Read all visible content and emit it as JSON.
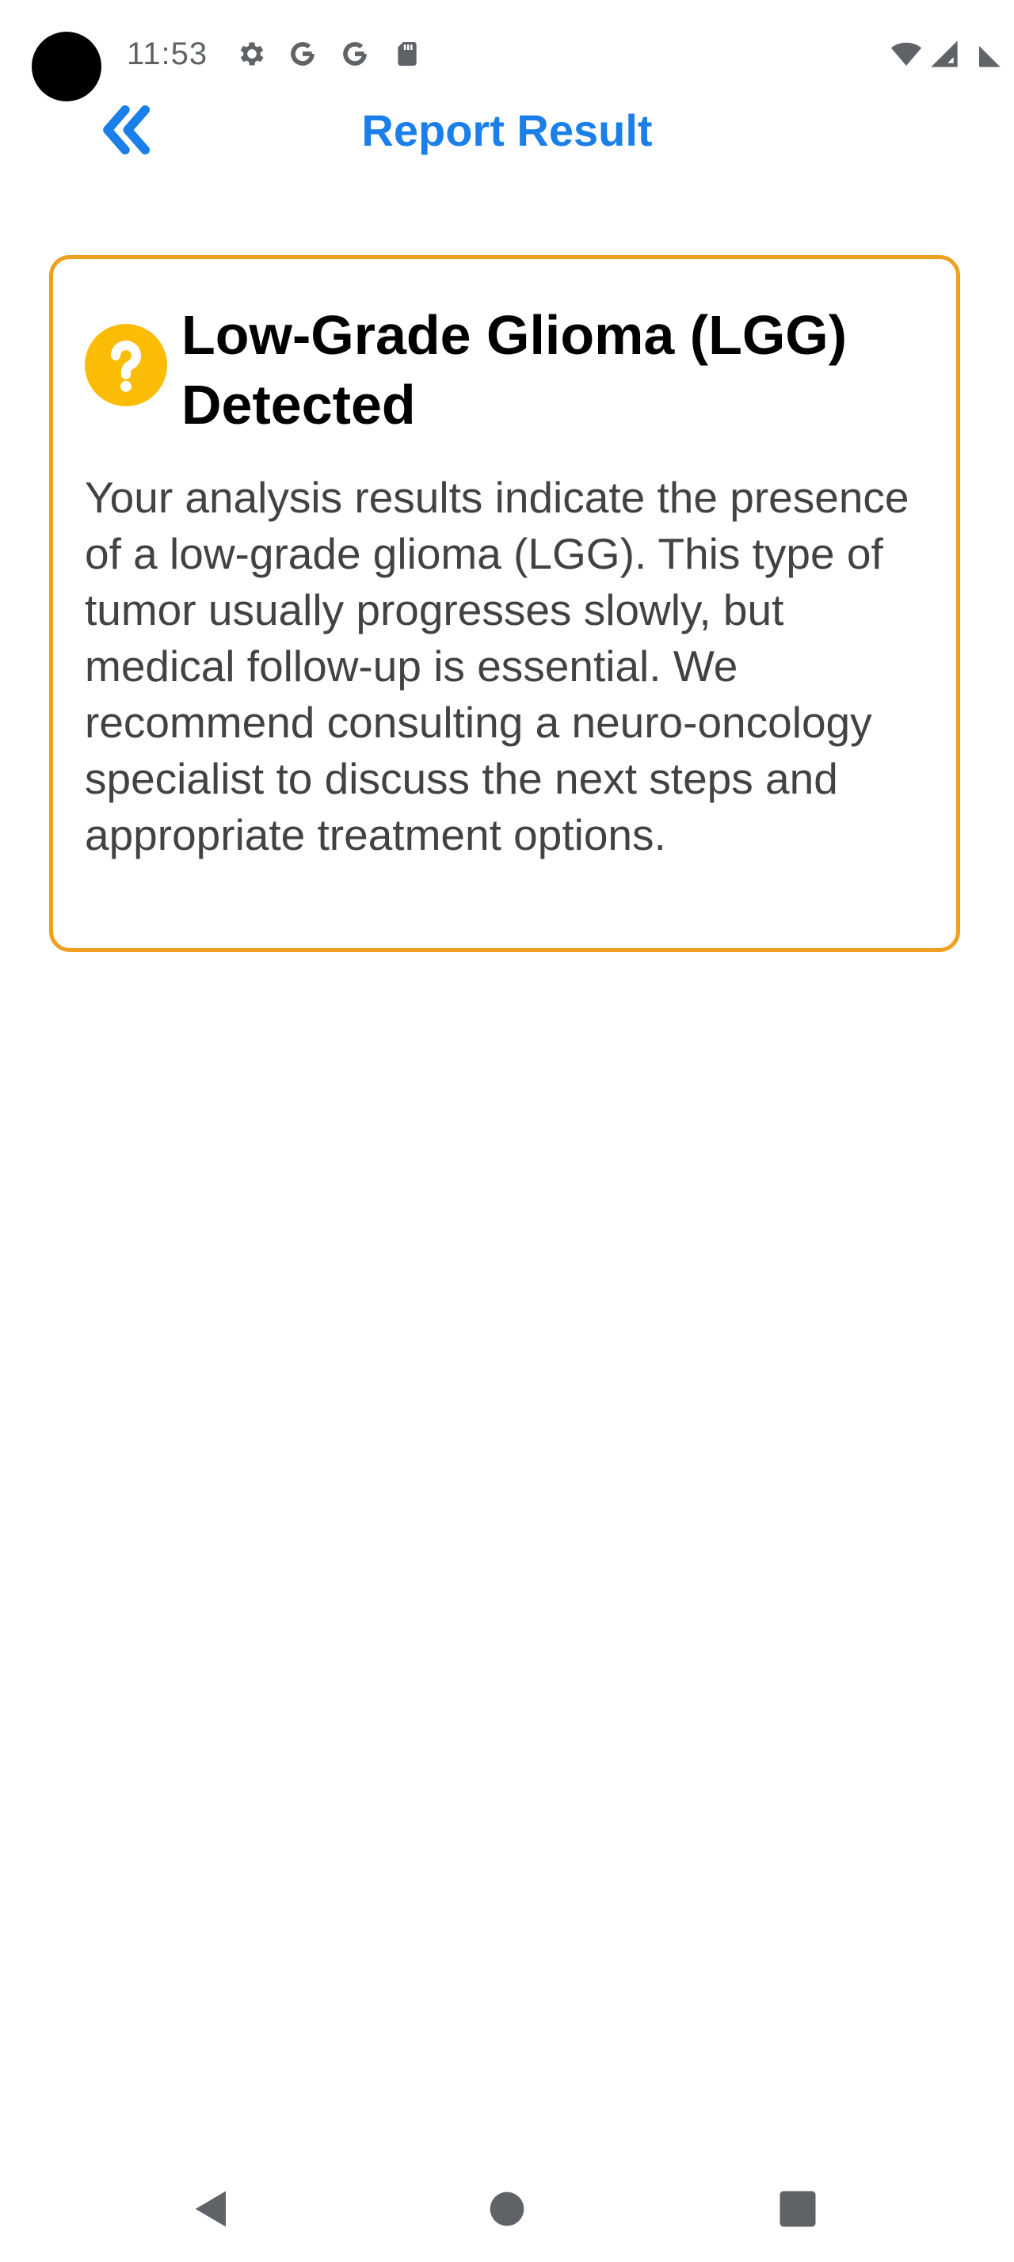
{
  "status_bar": {
    "time": "11:53",
    "icons": [
      "settings-icon",
      "google-icon",
      "google-icon",
      "sd-card-icon",
      "wifi-icon",
      "signal-icon",
      "signal-partial-icon"
    ]
  },
  "header": {
    "title": "Report Result",
    "back_icon": "double-chevron-left-icon",
    "accent_color": "#1a7fe8"
  },
  "result_card": {
    "icon": "question-mark-circle-icon",
    "icon_color": "#fbbc05",
    "border_color": "#f0a020",
    "title": "Low-Grade Glioma (LGG) Detected",
    "body": "Your analysis results indicate the presence of a low-grade glioma (LGG). This type of tumor usually progresses slowly, but medical follow-up is essential. We recommend consulting a neuro-oncology specialist to discuss the next steps and appropriate treatment options."
  },
  "nav_bar": {
    "buttons": [
      "back-triangle-icon",
      "home-circle-icon",
      "recents-square-icon"
    ]
  }
}
